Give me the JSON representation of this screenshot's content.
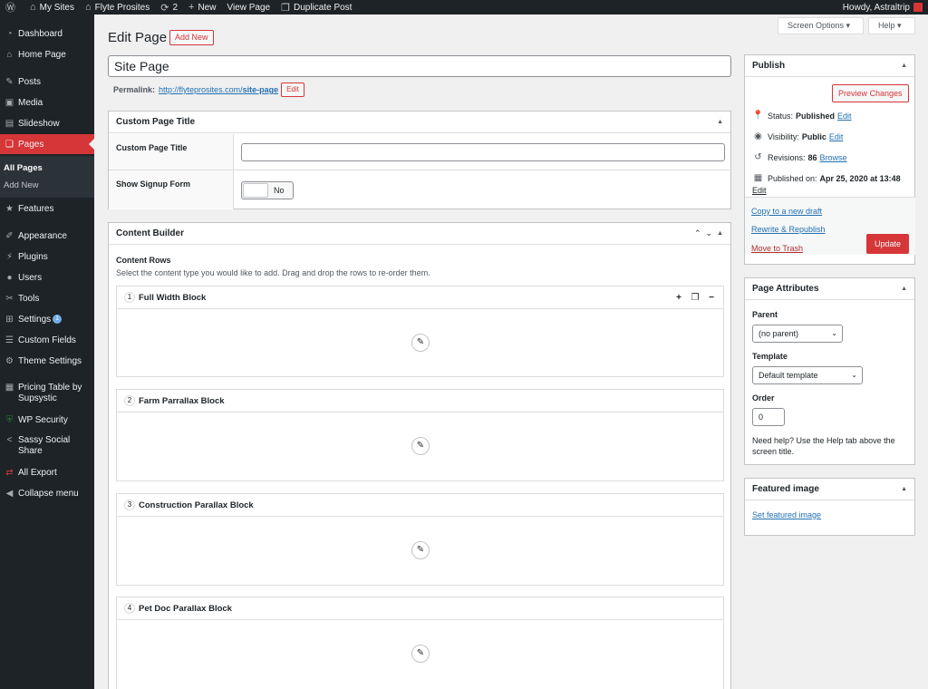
{
  "adminbar": {
    "items": [
      {
        "icon": "wordpress-icon",
        "glyph": "Ⓦ",
        "label": ""
      },
      {
        "icon": "home-network-icon",
        "glyph": "⌂",
        "label": "My Sites"
      },
      {
        "icon": "home-icon",
        "glyph": "⌂",
        "label": "Flyte Prosites"
      },
      {
        "icon": "updates-icon",
        "glyph": "⟳",
        "label": "2"
      },
      {
        "icon": "plus-icon",
        "glyph": "+",
        "label": "New"
      },
      {
        "icon": "",
        "glyph": "",
        "label": "View Page"
      },
      {
        "icon": "duplicate-icon",
        "glyph": "❐",
        "label": "Duplicate Post"
      }
    ],
    "greeting": "Howdy, Astraltrip"
  },
  "sidebar": {
    "items": [
      {
        "label": "Dashboard",
        "icon": "dashboard-icon",
        "glyph": "◔"
      },
      {
        "label": "Home Page",
        "icon": "home-icon",
        "glyph": "⌂"
      },
      {
        "label": "Posts",
        "icon": "pin-icon",
        "glyph": "✎"
      },
      {
        "label": "Media",
        "icon": "media-icon",
        "glyph": "▣"
      },
      {
        "label": "Slideshow",
        "icon": "slideshow-icon",
        "glyph": "▤"
      },
      {
        "label": "Pages",
        "icon": "pages-icon",
        "glyph": "❏"
      },
      {
        "label": "Features",
        "icon": "star-icon",
        "glyph": "★"
      },
      {
        "label": "Appearance",
        "icon": "brush-icon",
        "glyph": "✐"
      },
      {
        "label": "Plugins",
        "icon": "plugin-icon",
        "glyph": "⚡"
      },
      {
        "label": "Users",
        "icon": "user-icon",
        "glyph": "●"
      },
      {
        "label": "Tools",
        "icon": "wrench-icon",
        "glyph": "✂"
      },
      {
        "label": "Settings",
        "icon": "settings-icon",
        "glyph": "⊞",
        "badge": "1"
      },
      {
        "label": "Custom Fields",
        "icon": "fields-icon",
        "glyph": "☰"
      },
      {
        "label": "Theme Settings",
        "icon": "gear-icon",
        "glyph": "⚙"
      },
      {
        "label": "Pricing Table by Supsystic",
        "icon": "table-icon",
        "glyph": "▦"
      },
      {
        "label": "WP Security",
        "icon": "shield-icon",
        "glyph": "⛨"
      },
      {
        "label": "Sassy Social Share",
        "icon": "share-icon",
        "glyph": "<"
      },
      {
        "label": "All Export",
        "icon": "export-icon",
        "glyph": "⇄"
      },
      {
        "label": "Collapse menu",
        "icon": "collapse-icon",
        "glyph": "◀"
      }
    ],
    "submenu": [
      "All Pages",
      "Add New"
    ]
  },
  "header": {
    "title": "Edit Page",
    "add_new": "Add New",
    "screen_options": "Screen Options ▾",
    "help": "Help ▾"
  },
  "post": {
    "title": "Site Page",
    "permalink_label": "Permalink:",
    "permalink_base": "http://flyteprosites.com/",
    "permalink_slug": "site-page",
    "permalink_edit": "Edit"
  },
  "custom_title_box": {
    "heading": "Custom Page Title",
    "field_label": "Custom Page Title",
    "field_value": "",
    "signup_label": "Show Signup Form",
    "signup_value": "No"
  },
  "content_builder": {
    "heading": "Content Builder",
    "rows_title": "Content Rows",
    "rows_desc": "Select the content type you would like to add. Drag and drop the rows to re-order them.",
    "rows": [
      {
        "num": "1",
        "label": "Full Width Block"
      },
      {
        "num": "2",
        "label": "Farm Parrallax Block"
      },
      {
        "num": "3",
        "label": "Construction Parallax Block"
      },
      {
        "num": "4",
        "label": "Pet Doc Parallax Block"
      }
    ]
  },
  "publish": {
    "heading": "Publish",
    "preview": "Preview Changes",
    "status_label": "Status:",
    "status_value": "Published",
    "visibility_label": "Visibility:",
    "visibility_value": "Public",
    "revisions_label": "Revisions:",
    "revisions_value": "86",
    "browse": "Browse",
    "published_label": "Published on:",
    "published_value": "Apr 25, 2020 at 13:48",
    "edit": "Edit",
    "copy_draft": "Copy to a new draft",
    "rewrite": "Rewrite & Republish",
    "trash": "Move to Trash",
    "update": "Update"
  },
  "page_attributes": {
    "heading": "Page Attributes",
    "parent_label": "Parent",
    "parent_value": "(no parent)",
    "template_label": "Template",
    "template_value": "Default template",
    "order_label": "Order",
    "order_value": "0",
    "help": "Need help? Use the Help tab above the screen title."
  },
  "featured_image": {
    "heading": "Featured image",
    "link": "Set featured image"
  }
}
